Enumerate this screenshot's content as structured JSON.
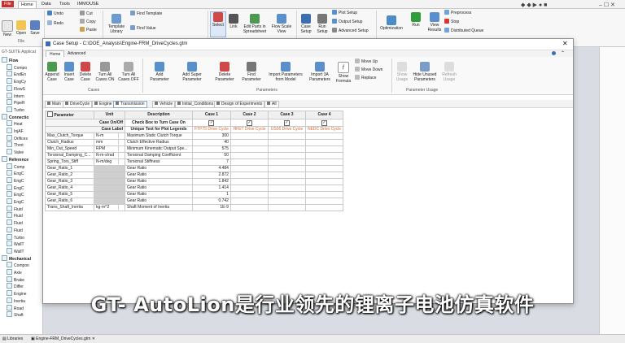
{
  "menubar": {
    "items": [
      "File",
      "Home",
      "Data",
      "Tools",
      "IMMOUSE"
    ]
  },
  "ribbon": {
    "file_group": {
      "label": "File",
      "buttons": [
        "New",
        "Open",
        "Save"
      ]
    },
    "edit_buttons": [
      "Undo",
      "Redo",
      "Cut",
      "Copy",
      "Paste"
    ],
    "template_library": "Template Library",
    "find_template": "Find Template",
    "find_value": "Find Value",
    "select": "Select",
    "link": "Link",
    "edit_parts": "Edit Parts in Spreadsheet",
    "flow_scale": "Flow Scale View",
    "case_setup": "Case Setup",
    "run_setup": "Run Setup",
    "plot_setup": "Plot Setup",
    "output_setup": "Output Setup",
    "advanced_setup": "Advanced Setup",
    "optimization": "Optimization",
    "run": "Run",
    "view_results": "View Results",
    "preprocess": "Preprocess",
    "stop": "Stop",
    "distributed_queue": "Distributed Queue"
  },
  "left_tree": {
    "header": "GT-SUITE Applicat",
    "items": [
      "Flow",
      "Compo",
      "EndEn",
      "EngCy",
      "FlowS",
      "Intern",
      "PipeR",
      "Turbo",
      "Connectio",
      "Heat",
      "InjAF",
      "Orifices",
      "Throt",
      "Valve",
      "Reference",
      "Comp",
      "EngC",
      "EngC",
      "EngC",
      "EngC",
      "EngC",
      "Fluid",
      "Fluid",
      "Fluid",
      "Fluid",
      "Turbo",
      "WallT",
      "WallT",
      "Mechanical",
      "Compon",
      "Axle",
      "Brake",
      "Differ",
      "Engine",
      "Inertia",
      "Road",
      "Shaft"
    ]
  },
  "statusbar": {
    "libraries": "Libraries",
    "file_tab": "Engine-FRM_DriveCycles.gtm"
  },
  "dialog": {
    "title": "Case Setup - C:\\DOE_Analysis\\Engine-FRM_DriveCycles.gtm",
    "tabs": [
      "Home",
      "Advanced"
    ],
    "cases_group": {
      "label": "Cases",
      "buttons": [
        "Append Case",
        "Insert Case",
        "Delete Case",
        "Turn All Cases ON",
        "Turn All Cases OFF"
      ]
    },
    "parameters_group": {
      "label": "Parameters",
      "buttons": [
        "Add Parameter",
        "Add Super Parameter",
        "Delete Parameter",
        "Find Parameter",
        "Import Parameters from Model",
        "Import 3A Parameters",
        "Show Formula"
      ],
      "small": [
        "Move Up",
        "Move Down",
        "Replace"
      ]
    },
    "usage_group": {
      "label": "Parameter Usage",
      "buttons": [
        "Show Usage",
        "Hide Unused Parameters",
        "Refresh Usage"
      ]
    },
    "folders": [
      "Main",
      "DriveCycle",
      "Engine",
      "Transmission",
      "Vehicle",
      "Initial_Conditions",
      "Design of Experiments",
      "All"
    ],
    "table": {
      "headers": [
        "Parameter",
        "Unit",
        "Description",
        "Case 1",
        "Case 2",
        "Case 3",
        "Case 4"
      ],
      "case_onoff": {
        "label": "Case On/Off",
        "description": "Check Box to Turn Case On"
      },
      "case_label": {
        "label": "Case Label",
        "description": "Unique Text for Plot Legends",
        "values": [
          "FTP75 Drive Cycle",
          "HFET Drive Cycle",
          "US06 Drive Cycle",
          "NEDC Drive Cycle"
        ]
      },
      "rows": [
        {
          "param": "Max_Clutch_Torque",
          "unit": "N-m",
          "desc": "Maximum Static Clutch Torque",
          "case1": "300"
        },
        {
          "param": "Clutch_Radius",
          "unit": "mm",
          "desc": "Clutch Effective Radius",
          "case1": "40"
        },
        {
          "param": "Min_Out_Speed",
          "unit": "RPM",
          "desc": "Minimum Kinematic Output Spe...",
          "case1": "575"
        },
        {
          "param": "Torsional_Damping_C...",
          "unit": "N-m-s/rad",
          "desc": "Torsional Damping Coefficient",
          "case1": "50"
        },
        {
          "param": "Spring_Tors_Stiff",
          "unit": "N-m/deg",
          "desc": "Torsional Stiffness",
          "case1": "7"
        },
        {
          "param": "Gear_Ratio_1",
          "unit": "",
          "desc": "Gear Ratio",
          "case1": "4.484"
        },
        {
          "param": "Gear_Ratio_2",
          "unit": "",
          "desc": "Gear Ratio",
          "case1": "2.872"
        },
        {
          "param": "Gear_Ratio_3",
          "unit": "",
          "desc": "Gear Ratio",
          "case1": "1.842"
        },
        {
          "param": "Gear_Ratio_4",
          "unit": "",
          "desc": "Gear Ratio",
          "case1": "1.414"
        },
        {
          "param": "Gear_Ratio_5",
          "unit": "",
          "desc": "Gear Ratio",
          "case1": "1"
        },
        {
          "param": "Gear_Ratio_6",
          "unit": "",
          "desc": "Gear Ratio",
          "case1": "0.742"
        },
        {
          "param": "Trans_Shaft_Inertia",
          "unit": "kg-m^2",
          "desc": "Shaft Moment of Inertia",
          "case1": "1E-9"
        }
      ]
    }
  },
  "subtitle": "GT- AutoLion是行业领先的锂离子电池仿真软件",
  "colors": {
    "file_menu": "#c8302f",
    "case_label": "#d46a34",
    "run_green": "#2e9e3a",
    "stop_red": "#d33"
  }
}
